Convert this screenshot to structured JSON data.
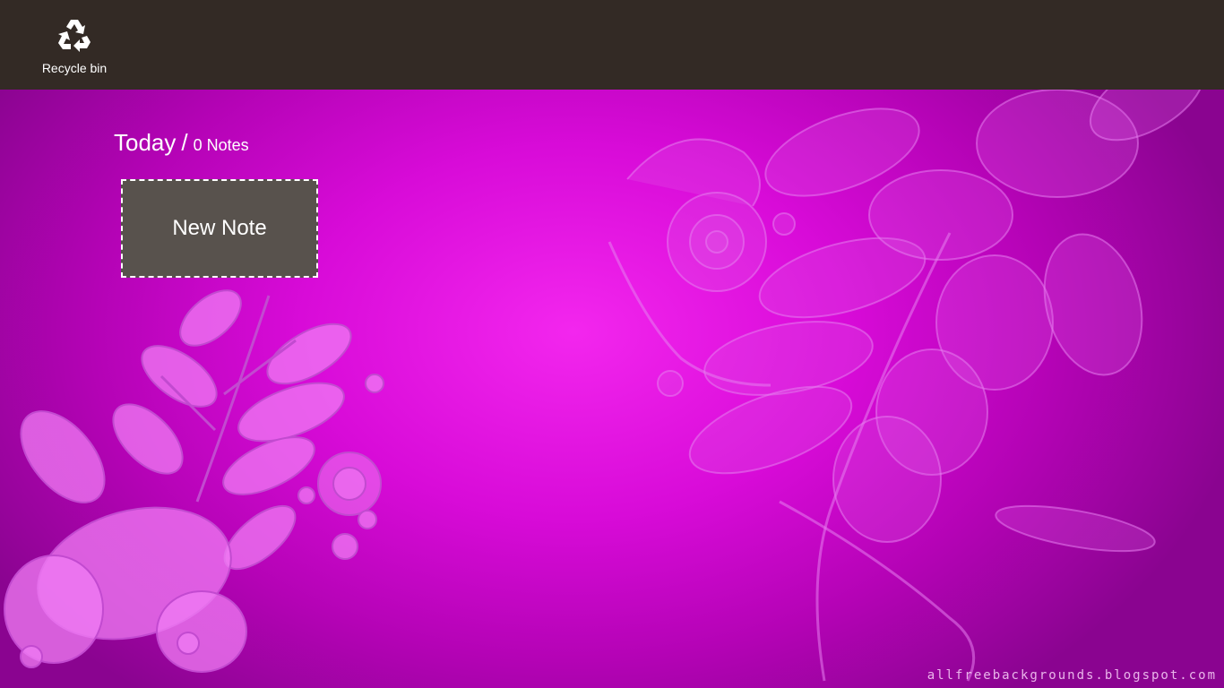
{
  "appbar": {
    "recycle_label": "Recycle bin",
    "recycle_icon": "recycle-icon",
    "background": "#332a25"
  },
  "page": {
    "day": "Today",
    "separator": "/",
    "note_count": "0 Notes",
    "new_note_label": "New Note",
    "watermark": "allfreebackgrounds.blogspot.com",
    "background_accent": "#e010e0",
    "tile_color": "#58524d"
  }
}
